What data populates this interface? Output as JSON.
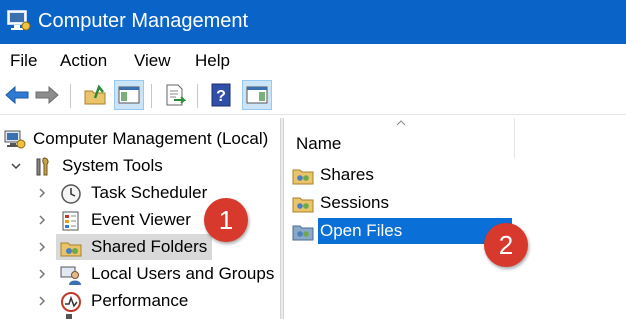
{
  "window": {
    "title": "Computer Management"
  },
  "menu": {
    "items": [
      {
        "label": "File"
      },
      {
        "label": "Action"
      },
      {
        "label": "View"
      },
      {
        "label": "Help"
      }
    ]
  },
  "toolbar": {
    "buttons": [
      {
        "icon": "back-arrow-icon"
      },
      {
        "icon": "forward-arrow-icon"
      },
      {
        "icon": "up-folder-icon"
      },
      {
        "icon": "show-hide-console-tree-icon"
      },
      {
        "icon": "export-list-icon"
      },
      {
        "icon": "help-icon"
      },
      {
        "icon": "show-hide-action-pane-icon"
      }
    ]
  },
  "tree": {
    "root": {
      "label": "Computer Management (Local)",
      "icon": "computer-management-icon"
    },
    "system_tools": {
      "label": "System Tools",
      "icon": "tools-icon"
    },
    "items": [
      {
        "label": "Task Scheduler",
        "icon": "clock-icon"
      },
      {
        "label": "Event Viewer",
        "icon": "event-viewer-icon"
      },
      {
        "label": "Shared Folders",
        "icon": "shared-folders-icon",
        "selected": true
      },
      {
        "label": "Local Users and Groups",
        "icon": "users-icon"
      },
      {
        "label": "Performance",
        "icon": "performance-icon"
      }
    ]
  },
  "list": {
    "column_header": "Name",
    "items": [
      {
        "label": "Shares",
        "icon": "shares-folder-icon"
      },
      {
        "label": "Sessions",
        "icon": "sessions-folder-icon"
      },
      {
        "label": "Open Files",
        "icon": "open-files-folder-icon",
        "selected": true
      }
    ]
  },
  "callouts": [
    {
      "label": "1"
    },
    {
      "label": "2"
    }
  ],
  "colors": {
    "titlebar": "#0a64c8",
    "selection": "#0a6fd6",
    "callout": "#d73a2d"
  }
}
